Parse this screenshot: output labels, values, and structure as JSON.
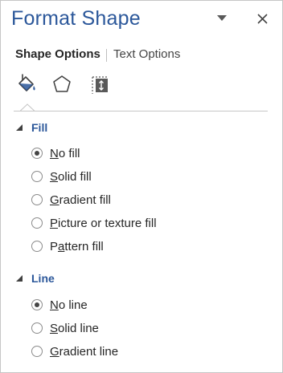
{
  "pane": {
    "title": "Format Shape",
    "menu_icon": "dropdown-triangle-icon",
    "close_icon": "close-icon"
  },
  "tabs": [
    {
      "label": "Shape Options",
      "selected": true
    },
    {
      "label": "Text Options",
      "selected": false
    }
  ],
  "category_icons": [
    "fill-line-paint-bucket-icon",
    "effects-pentagon-icon",
    "size-properties-icon"
  ],
  "sections": {
    "fill": {
      "label": "Fill",
      "expanded": true,
      "options": [
        {
          "mnemonic": "N",
          "rest": "o fill",
          "checked": true
        },
        {
          "mnemonic": "S",
          "rest": "olid fill",
          "checked": false
        },
        {
          "mnemonic": "G",
          "rest": "radient fill",
          "checked": false
        },
        {
          "mnemonic": "P",
          "rest": "icture or texture fill",
          "checked": false
        },
        {
          "prefix": "P",
          "mnemonic": "a",
          "rest": "ttern fill",
          "checked": false
        }
      ]
    },
    "line": {
      "label": "Line",
      "expanded": true,
      "options": [
        {
          "mnemonic": "N",
          "rest": "o line",
          "checked": true
        },
        {
          "mnemonic": "S",
          "rest": "olid line",
          "checked": false
        },
        {
          "mnemonic": "G",
          "rest": "radient line",
          "checked": false
        }
      ]
    }
  },
  "colors": {
    "accent": "#2b579a",
    "text": "#262626",
    "border": "#c6c6c6"
  }
}
